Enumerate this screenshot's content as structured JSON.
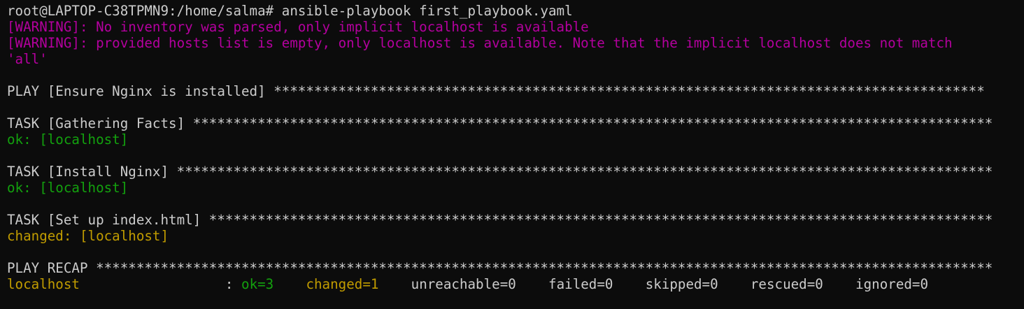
{
  "terminal": {
    "colors": {
      "background": "#0c0c0c",
      "default": "#cccccc",
      "warning": "#b4009e",
      "ok": "#13a10e",
      "changed": "#c19c00"
    },
    "prompt": "root@LAPTOP-C38TPMN9:/home/salma# ",
    "command": "ansible-playbook first_playbook.yaml",
    "warnings": [
      "[WARNING]: No inventory was parsed, only implicit localhost is available",
      "[WARNING]: provided hosts list is empty, only localhost is available. Note that the implicit localhost does not match",
      "'all'"
    ],
    "play_header": "PLAY [Ensure Nginx is installed] ****************************************************************************************",
    "tasks": [
      {
        "header": "TASK [Gathering Facts] ***************************************************************************************************",
        "result": "ok: [localhost]"
      },
      {
        "header": "TASK [Install Nginx] *****************************************************************************************************",
        "result": "ok: [localhost]"
      },
      {
        "header": "TASK [Set up index.html] *************************************************************************************************",
        "result": "changed: [localhost]"
      }
    ],
    "recap_header": "PLAY RECAP ***************************************************************************************************************",
    "recap": {
      "host": "localhost",
      "sep": "                  : ",
      "ok": "ok=3",
      "changed": "changed=1",
      "unreachable": "unreachable=0",
      "failed": "failed=0",
      "skipped": "skipped=0",
      "rescued": "rescued=0",
      "ignored": "ignored=0",
      "gap_ok": "    ",
      "gap_changed": "    ",
      "gap_unreach": "    ",
      "gap_failed": "    ",
      "gap_skipped": "    ",
      "gap_rescued": "    "
    }
  }
}
